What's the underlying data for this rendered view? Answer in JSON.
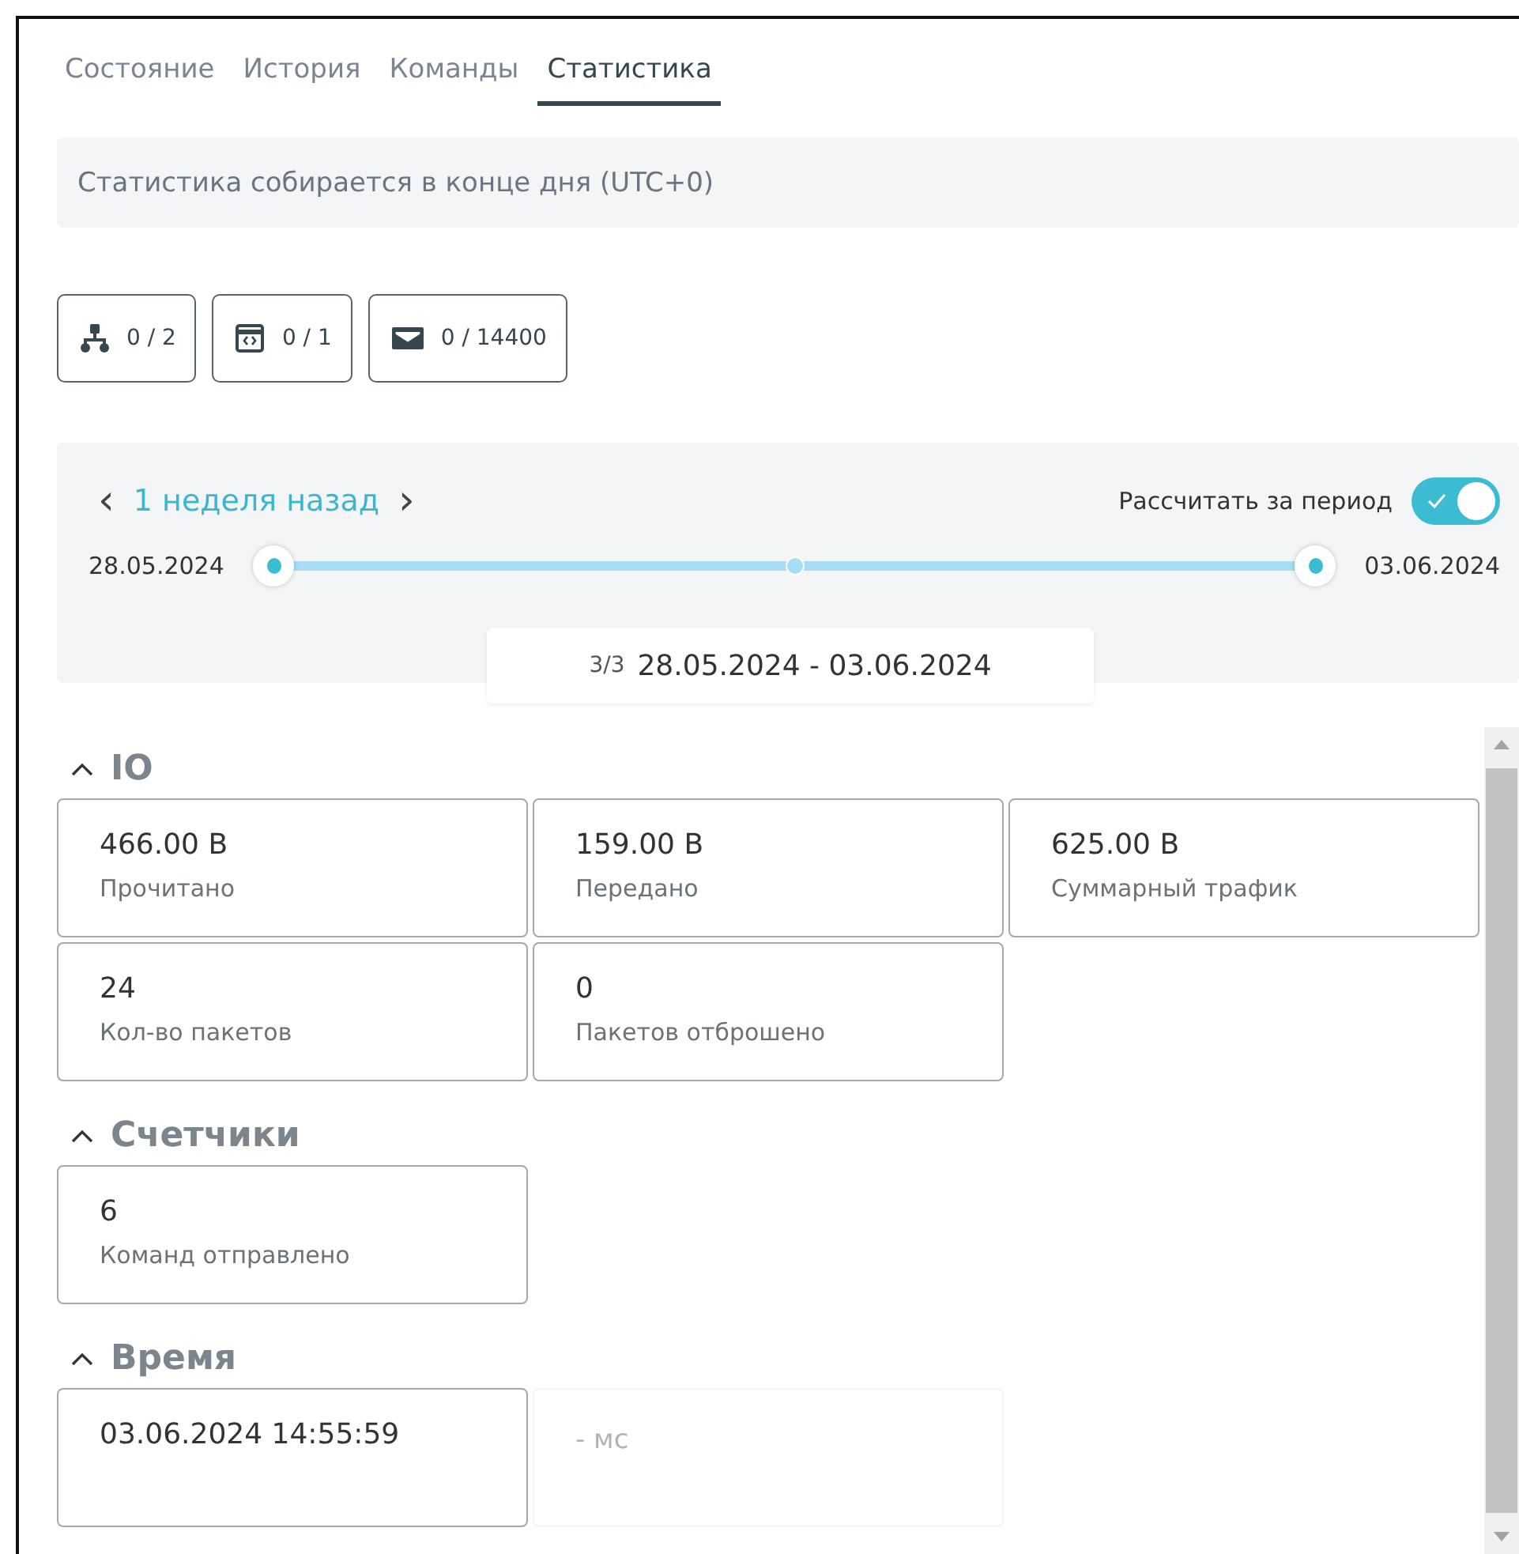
{
  "tabs": [
    {
      "label": "Состояние",
      "selected": false
    },
    {
      "label": "История",
      "selected": false
    },
    {
      "label": "Команды",
      "selected": false
    },
    {
      "label": "Статистика",
      "selected": true
    }
  ],
  "notice": "Статистика собирается в конце дня (UTC+0)",
  "limits": [
    {
      "kind": "tree",
      "text": "0 / 2"
    },
    {
      "kind": "code",
      "text": "0 / 1"
    },
    {
      "kind": "mail",
      "text": "0 / 14400"
    }
  ],
  "period": {
    "prev": "‹",
    "label": "1 неделя назад",
    "next": "›",
    "toggle_label": "Рассчитать за период",
    "toggle_on": true,
    "start_date": "28.05.2024",
    "end_date": "03.06.2024",
    "markers": [
      {
        "kind": "handle",
        "level": 0
      },
      {
        "kind": "tick",
        "level": 0.5
      },
      {
        "kind": "handle",
        "level": 1
      }
    ],
    "range_count": "3/3",
    "range": "28.05.2024 - 03.06.2024"
  },
  "sections": [
    {
      "title": "IO",
      "expanded": true,
      "cards": [
        {
          "value": "466.00 B",
          "label": "Прочитано",
          "muted": false
        },
        {
          "value": "159.00 B",
          "label": "Передано",
          "muted": false
        },
        {
          "value": "625.00 B",
          "label": "Суммарный трафик",
          "muted": false
        },
        {
          "value": "24",
          "label": "Кол-во пакетов",
          "muted": false
        },
        {
          "value": "0",
          "label": "Пакетов отброшено",
          "muted": false
        }
      ]
    },
    {
      "title": "Счетчики",
      "expanded": true,
      "cards": [
        {
          "value": "6",
          "label": "Команд отправлено",
          "muted": false
        }
      ]
    },
    {
      "title": "Время",
      "expanded": true,
      "cards": [
        {
          "value": "03.06.2024 14:55:59",
          "muted": false
        },
        {
          "value": "- мс",
          "muted": true
        }
      ]
    }
  ]
}
